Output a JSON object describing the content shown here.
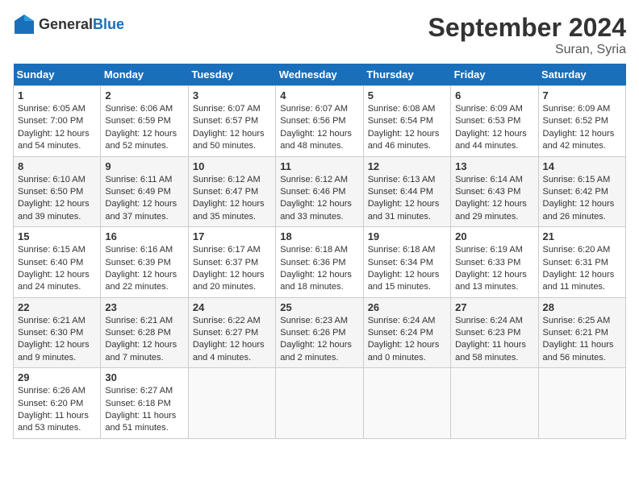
{
  "header": {
    "logo_general": "General",
    "logo_blue": "Blue",
    "month_title": "September 2024",
    "location": "Suran, Syria"
  },
  "days_of_week": [
    "Sunday",
    "Monday",
    "Tuesday",
    "Wednesday",
    "Thursday",
    "Friday",
    "Saturday"
  ],
  "weeks": [
    [
      {
        "day": "1",
        "info": "Sunrise: 6:05 AM\nSunset: 7:00 PM\nDaylight: 12 hours\nand 54 minutes."
      },
      {
        "day": "2",
        "info": "Sunrise: 6:06 AM\nSunset: 6:59 PM\nDaylight: 12 hours\nand 52 minutes."
      },
      {
        "day": "3",
        "info": "Sunrise: 6:07 AM\nSunset: 6:57 PM\nDaylight: 12 hours\nand 50 minutes."
      },
      {
        "day": "4",
        "info": "Sunrise: 6:07 AM\nSunset: 6:56 PM\nDaylight: 12 hours\nand 48 minutes."
      },
      {
        "day": "5",
        "info": "Sunrise: 6:08 AM\nSunset: 6:54 PM\nDaylight: 12 hours\nand 46 minutes."
      },
      {
        "day": "6",
        "info": "Sunrise: 6:09 AM\nSunset: 6:53 PM\nDaylight: 12 hours\nand 44 minutes."
      },
      {
        "day": "7",
        "info": "Sunrise: 6:09 AM\nSunset: 6:52 PM\nDaylight: 12 hours\nand 42 minutes."
      }
    ],
    [
      {
        "day": "8",
        "info": "Sunrise: 6:10 AM\nSunset: 6:50 PM\nDaylight: 12 hours\nand 39 minutes."
      },
      {
        "day": "9",
        "info": "Sunrise: 6:11 AM\nSunset: 6:49 PM\nDaylight: 12 hours\nand 37 minutes."
      },
      {
        "day": "10",
        "info": "Sunrise: 6:12 AM\nSunset: 6:47 PM\nDaylight: 12 hours\nand 35 minutes."
      },
      {
        "day": "11",
        "info": "Sunrise: 6:12 AM\nSunset: 6:46 PM\nDaylight: 12 hours\nand 33 minutes."
      },
      {
        "day": "12",
        "info": "Sunrise: 6:13 AM\nSunset: 6:44 PM\nDaylight: 12 hours\nand 31 minutes."
      },
      {
        "day": "13",
        "info": "Sunrise: 6:14 AM\nSunset: 6:43 PM\nDaylight: 12 hours\nand 29 minutes."
      },
      {
        "day": "14",
        "info": "Sunrise: 6:15 AM\nSunset: 6:42 PM\nDaylight: 12 hours\nand 26 minutes."
      }
    ],
    [
      {
        "day": "15",
        "info": "Sunrise: 6:15 AM\nSunset: 6:40 PM\nDaylight: 12 hours\nand 24 minutes."
      },
      {
        "day": "16",
        "info": "Sunrise: 6:16 AM\nSunset: 6:39 PM\nDaylight: 12 hours\nand 22 minutes."
      },
      {
        "day": "17",
        "info": "Sunrise: 6:17 AM\nSunset: 6:37 PM\nDaylight: 12 hours\nand 20 minutes."
      },
      {
        "day": "18",
        "info": "Sunrise: 6:18 AM\nSunset: 6:36 PM\nDaylight: 12 hours\nand 18 minutes."
      },
      {
        "day": "19",
        "info": "Sunrise: 6:18 AM\nSunset: 6:34 PM\nDaylight: 12 hours\nand 15 minutes."
      },
      {
        "day": "20",
        "info": "Sunrise: 6:19 AM\nSunset: 6:33 PM\nDaylight: 12 hours\nand 13 minutes."
      },
      {
        "day": "21",
        "info": "Sunrise: 6:20 AM\nSunset: 6:31 PM\nDaylight: 12 hours\nand 11 minutes."
      }
    ],
    [
      {
        "day": "22",
        "info": "Sunrise: 6:21 AM\nSunset: 6:30 PM\nDaylight: 12 hours\nand 9 minutes."
      },
      {
        "day": "23",
        "info": "Sunrise: 6:21 AM\nSunset: 6:28 PM\nDaylight: 12 hours\nand 7 minutes."
      },
      {
        "day": "24",
        "info": "Sunrise: 6:22 AM\nSunset: 6:27 PM\nDaylight: 12 hours\nand 4 minutes."
      },
      {
        "day": "25",
        "info": "Sunrise: 6:23 AM\nSunset: 6:26 PM\nDaylight: 12 hours\nand 2 minutes."
      },
      {
        "day": "26",
        "info": "Sunrise: 6:24 AM\nSunset: 6:24 PM\nDaylight: 12 hours\nand 0 minutes."
      },
      {
        "day": "27",
        "info": "Sunrise: 6:24 AM\nSunset: 6:23 PM\nDaylight: 11 hours\nand 58 minutes."
      },
      {
        "day": "28",
        "info": "Sunrise: 6:25 AM\nSunset: 6:21 PM\nDaylight: 11 hours\nand 56 minutes."
      }
    ],
    [
      {
        "day": "29",
        "info": "Sunrise: 6:26 AM\nSunset: 6:20 PM\nDaylight: 11 hours\nand 53 minutes."
      },
      {
        "day": "30",
        "info": "Sunrise: 6:27 AM\nSunset: 6:18 PM\nDaylight: 11 hours\nand 51 minutes."
      },
      null,
      null,
      null,
      null,
      null
    ]
  ]
}
